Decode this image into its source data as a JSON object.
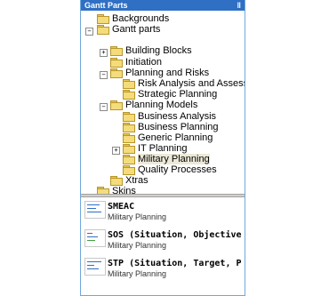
{
  "panel": {
    "title": "Gantt Parts",
    "pin_glyph": "‖"
  },
  "tree": {
    "items": [
      {
        "label": "Backgrounds"
      },
      {
        "label": "Gantt parts",
        "exp": "−"
      },
      {
        "label": "Building Blocks",
        "exp": "+"
      },
      {
        "label": "Initiation"
      },
      {
        "label": "Planning and Risks",
        "exp": "−"
      },
      {
        "label": "Risk Analysis and Assessment"
      },
      {
        "label": "Strategic Planning"
      },
      {
        "label": "Planning Models",
        "exp": "−"
      },
      {
        "label": "Business Analysis"
      },
      {
        "label": "Business Planning"
      },
      {
        "label": "Generic Planning"
      },
      {
        "label": "IT Planning",
        "exp": "+"
      },
      {
        "label": "Military Planning",
        "selected": true
      },
      {
        "label": "Quality Processes"
      },
      {
        "label": "Xtras"
      },
      {
        "label": "Skins"
      }
    ]
  },
  "templates": [
    {
      "title": "SMEAC",
      "category": "Military Planning"
    },
    {
      "title": "SOS (Situation, Objective",
      "category": "Military Planning"
    },
    {
      "title": "STP (Situation, Target, P",
      "category": "Military Planning"
    }
  ]
}
